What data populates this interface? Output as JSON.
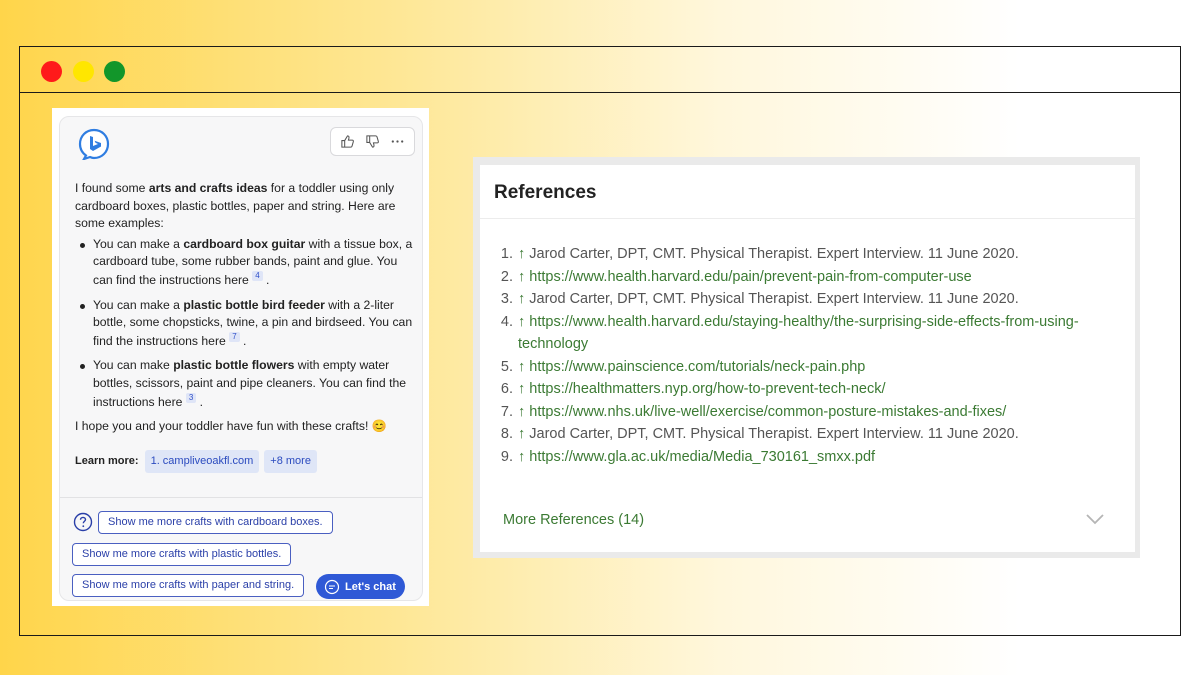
{
  "window": {
    "controls": [
      "close",
      "minimize",
      "maximize"
    ]
  },
  "chat": {
    "intro_pre": "I found some ",
    "intro_bold": "arts and crafts ideas",
    "intro_post": " for a toddler using only cardboard boxes, plastic bottles, paper and string. Here are some examples:",
    "items": [
      {
        "pre": "You can make a ",
        "bold": "cardboard box guitar",
        "post": " with a tissue box, a cardboard tube, some rubber bands, paint and glue. You can find the instructions here",
        "ref": "4"
      },
      {
        "pre": "You can make a ",
        "bold": "plastic bottle bird feeder",
        "post": " with a 2-liter bottle, some chopsticks, twine, a pin and birdseed. You can find the instructions here",
        "ref": "7"
      },
      {
        "pre": "You can make ",
        "bold": "plastic bottle flowers",
        "post": " with empty water bottles, scissors, paint and pipe cleaners. You can find the instructions here",
        "ref": "3"
      }
    ],
    "outro": "I hope you and your toddler have fun with these crafts! 😊",
    "learn_more_label": "Learn more:",
    "learn_more_link": "1. campliveoakfl.com",
    "learn_more_extra": "+8 more",
    "suggestions": [
      "Show me more crafts with cardboard boxes.",
      "Show me more crafts with plastic bottles.",
      "Show me more crafts with paper and string."
    ],
    "lets_chat_label": "Let's chat",
    "icons": {
      "logo": "bing-logo-icon",
      "thumbs_up": "thumbs-up-icon",
      "thumbs_down": "thumbs-down-icon",
      "more": "more-options-icon",
      "help": "question-icon",
      "chat": "chat-bubble-icon"
    }
  },
  "references": {
    "title": "References",
    "items": [
      {
        "num": "1.",
        "arrow": "↑",
        "text": "Jarod Carter, DPT, CMT. Physical Therapist. Expert Interview. 11 June 2020.",
        "link": false
      },
      {
        "num": "2.",
        "arrow": "↑",
        "text": "https://www.health.harvard.edu/pain/prevent-pain-from-computer-use",
        "link": true
      },
      {
        "num": "3.",
        "arrow": "↑",
        "text": "Jarod Carter, DPT, CMT. Physical Therapist. Expert Interview. 11 June 2020.",
        "link": false
      },
      {
        "num": "4.",
        "arrow": "↑",
        "text": "https://www.health.harvard.edu/staying-healthy/the-surprising-side-effects-from-using-technology",
        "link": true
      },
      {
        "num": "5.",
        "arrow": "↑",
        "text": "https://www.painscience.com/tutorials/neck-pain.php",
        "link": true
      },
      {
        "num": "6.",
        "arrow": "↑",
        "text": "https://healthmatters.nyp.org/how-to-prevent-tech-neck/",
        "link": true
      },
      {
        "num": "7.",
        "arrow": "↑",
        "text": "https://www.nhs.uk/live-well/exercise/common-posture-mistakes-and-fixes/",
        "link": true
      },
      {
        "num": "8.",
        "arrow": "↑",
        "text": "Jarod Carter, DPT, CMT. Physical Therapist. Expert Interview. 11 June 2020.",
        "link": false
      },
      {
        "num": "9.",
        "arrow": "↑",
        "text": "https://www.gla.ac.uk/media/Media_730161_smxx.pdf",
        "link": true
      }
    ],
    "more_label": "More References (14)",
    "expand_icon": "chevron-down-icon"
  },
  "colors": {
    "accent_blue": "#2f59d6",
    "link_green": "#3b7a33",
    "dot_red": "#ff1a1a",
    "dot_yellow": "#ffe600",
    "dot_green": "#12962a"
  }
}
